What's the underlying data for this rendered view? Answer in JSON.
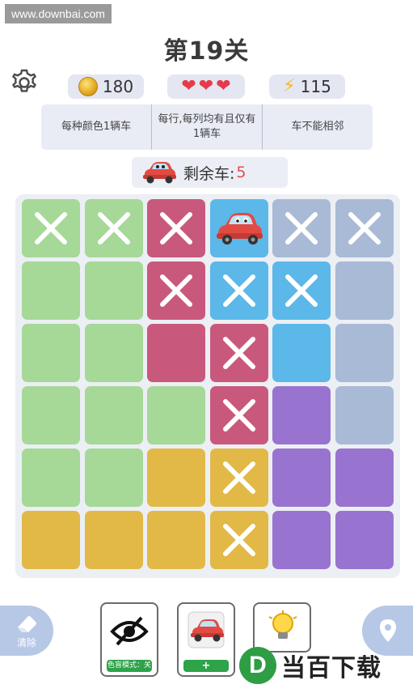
{
  "watermark": "www.downbai.com",
  "level_title": "第19关",
  "stats": {
    "coins": "180",
    "hearts": 3,
    "energy": "115"
  },
  "rules": [
    "每种颜色1辆车",
    "每行,每列均有且仅有1辆车",
    "车不能相邻"
  ],
  "remaining": {
    "label": "剩余车:",
    "count": "5"
  },
  "colors": {
    "green": "#a6d898",
    "pink": "#c9597c",
    "blue": "#5bb8e8",
    "steel": "#a8bad6",
    "purple": "#9873cf",
    "yellow": "#e2b947"
  },
  "board": {
    "rows": [
      [
        {
          "c": "green",
          "m": "x"
        },
        {
          "c": "green",
          "m": "x"
        },
        {
          "c": "pink",
          "m": "x"
        },
        {
          "c": "blue",
          "m": "car"
        },
        {
          "c": "steel",
          "m": "x"
        },
        {
          "c": "steel",
          "m": "x"
        }
      ],
      [
        {
          "c": "green",
          "m": ""
        },
        {
          "c": "green",
          "m": ""
        },
        {
          "c": "pink",
          "m": "x"
        },
        {
          "c": "blue",
          "m": "x"
        },
        {
          "c": "blue",
          "m": "x"
        },
        {
          "c": "steel",
          "m": ""
        }
      ],
      [
        {
          "c": "green",
          "m": ""
        },
        {
          "c": "green",
          "m": ""
        },
        {
          "c": "pink",
          "m": ""
        },
        {
          "c": "pink",
          "m": "x"
        },
        {
          "c": "blue",
          "m": ""
        },
        {
          "c": "steel",
          "m": ""
        }
      ],
      [
        {
          "c": "green",
          "m": ""
        },
        {
          "c": "green",
          "m": ""
        },
        {
          "c": "green",
          "m": ""
        },
        {
          "c": "pink",
          "m": "x"
        },
        {
          "c": "purple",
          "m": ""
        },
        {
          "c": "steel",
          "m": ""
        }
      ],
      [
        {
          "c": "green",
          "m": ""
        },
        {
          "c": "green",
          "m": ""
        },
        {
          "c": "yellow",
          "m": ""
        },
        {
          "c": "yellow",
          "m": "x"
        },
        {
          "c": "purple",
          "m": ""
        },
        {
          "c": "purple",
          "m": ""
        }
      ],
      [
        {
          "c": "yellow",
          "m": ""
        },
        {
          "c": "yellow",
          "m": ""
        },
        {
          "c": "yellow",
          "m": ""
        },
        {
          "c": "yellow",
          "m": "x"
        },
        {
          "c": "purple",
          "m": ""
        },
        {
          "c": "purple",
          "m": ""
        }
      ]
    ]
  },
  "tools": {
    "clear_label": "清除",
    "colorblind_label": "色盲模式：关",
    "add_car_label": "+"
  },
  "brand": {
    "logo": "D",
    "text": "当百下载"
  }
}
